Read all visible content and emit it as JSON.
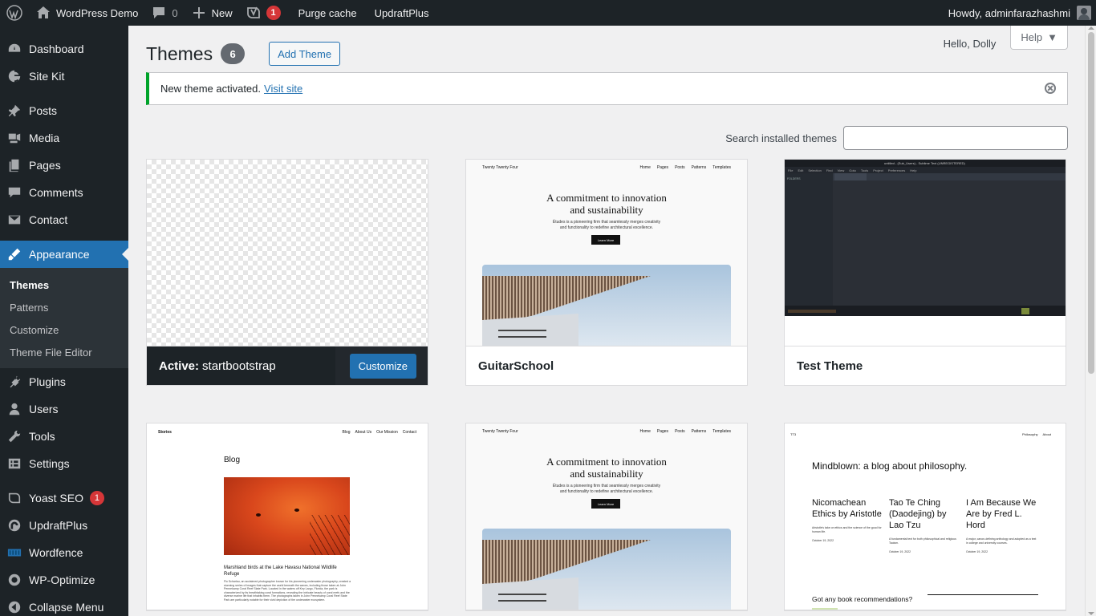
{
  "admin_bar": {
    "site_name": "WordPress Demo",
    "comments_count": "0",
    "new_label": "New",
    "yoast_badge": "1",
    "purge_cache": "Purge cache",
    "updraftplus": "UpdraftPlus",
    "howdy": "Howdy, adminfarazhashmi"
  },
  "sidebar": {
    "items": [
      {
        "label": "Dashboard",
        "icon": "dashboard-icon"
      },
      {
        "label": "Site Kit",
        "icon": "site-kit-icon"
      },
      {
        "label": "Posts",
        "icon": "pin-icon"
      },
      {
        "label": "Media",
        "icon": "media-icon"
      },
      {
        "label": "Pages",
        "icon": "pages-icon"
      },
      {
        "label": "Comments",
        "icon": "comment-icon"
      },
      {
        "label": "Contact",
        "icon": "mail-icon"
      },
      {
        "label": "Appearance",
        "icon": "brush-icon"
      },
      {
        "label": "Plugins",
        "icon": "plug-icon"
      },
      {
        "label": "Users",
        "icon": "user-icon"
      },
      {
        "label": "Tools",
        "icon": "wrench-icon"
      },
      {
        "label": "Settings",
        "icon": "settings-icon"
      },
      {
        "label": "Yoast SEO",
        "icon": "yoast-icon",
        "badge": "1"
      },
      {
        "label": "UpdraftPlus",
        "icon": "updraft-icon"
      },
      {
        "label": "Wordfence",
        "icon": "wordfence-icon"
      },
      {
        "label": "WP-Optimize",
        "icon": "optimize-icon"
      },
      {
        "label": "Collapse Menu",
        "icon": "collapse-icon"
      }
    ],
    "appearance_sub": [
      "Themes",
      "Patterns",
      "Customize",
      "Theme File Editor"
    ]
  },
  "header": {
    "hello_dolly": "Hello, Dolly",
    "help": "Help",
    "title": "Themes",
    "count": "6",
    "add_theme": "Add Theme"
  },
  "notice": {
    "text": "New theme activated.",
    "link": "Visit site"
  },
  "search": {
    "label": "Search installed themes",
    "value": ""
  },
  "themes": {
    "active_prefix": "Active:",
    "active_name": "startbootstrap",
    "customize": "Customize",
    "names": [
      "GuitarSchool",
      "Test Theme"
    ]
  },
  "previews": {
    "tt4": {
      "brand": "Twenty Twenty Four",
      "nav": [
        "Home",
        "Pages",
        "Posts",
        "Patterns",
        "Templates"
      ],
      "headline_1": "A commitment to innovation",
      "headline_2": "and sustainability",
      "sub_1": "Études is a pioneering firm that seamlessly merges creativity",
      "sub_2": "and functionality to redefine architectural excellence.",
      "button": "Learn More"
    },
    "stories": {
      "brand": "Stories",
      "nav": [
        "Blog",
        "About Us",
        "Our Mission",
        "Contact"
      ],
      "title": "Blog",
      "caption": "Marshland birds at the Lake Havasu National Wildlife Refuge",
      "body": "Flo Scharlau, an acclaimed photographer known for his pioneering underwater photography, created a stunning series of images that capture the world beneath the waves, including those taken at John Pennekamp Coral Reef State Park. Located in the waters off Key Largo, Florida, the park is characterized by its breathtaking coral formations, revealing the intricate beauty of coral reefs and the diverse marine life that inhabits them. The photographs taken in John Pennekamp Coral Reef State Park are particularly notable for their vivid depiction of the underwater ecosystem."
    },
    "tt3": {
      "brand": "TT3",
      "nav": [
        "Philosophy",
        "About"
      ],
      "headline": "Mindblown: a blog about philosophy.",
      "posts": [
        {
          "title": "Nicomachean Ethics by Aristotle",
          "desc": "Aristotle's take on ethics and the science of the good for human life.",
          "date": "October 19, 2022"
        },
        {
          "title": "Tao Te Ching (Daodejing) by Lao Tzu",
          "desc": "A fundamental text for both philosophical and religious Taoism.",
          "date": "October 19, 2022"
        },
        {
          "title": "I Am Because We Are by Fred L. Hord",
          "desc": "A major, canon-defining anthology and adopted as a text in college and university courses.",
          "date": "October 19, 2022"
        }
      ],
      "question": "Got any book recommendations?"
    },
    "editor": {
      "title": "untitled - (Sub_Users) - Sublime Text (UNREGISTERED)",
      "menu": [
        "File",
        "Edit",
        "Selection",
        "Find",
        "View",
        "Goto",
        "Tools",
        "Project",
        "Preferences",
        "Help"
      ],
      "folders_label": "FOLDERS"
    }
  },
  "colors": {
    "admin_bg": "#1d2327",
    "accent": "#2271b1",
    "success": "#00a32a",
    "badge": "#d63638"
  }
}
